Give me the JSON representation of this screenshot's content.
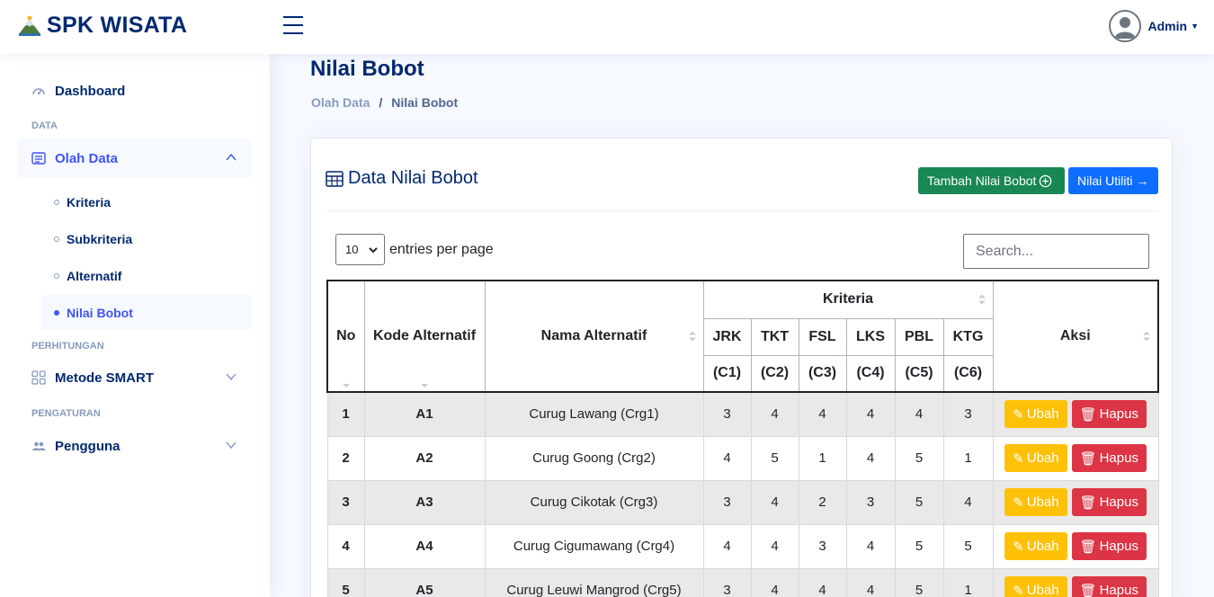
{
  "header": {
    "app_title": "SPK WISATA",
    "user_name": "Admin"
  },
  "sidebar": {
    "dashboard": "Dashboard",
    "heading_data": "DATA",
    "olah_data": "Olah Data",
    "sub_items": [
      "Kriteria",
      "Subkriteria",
      "Alternatif",
      "Nilai Bobot"
    ],
    "heading_perhitungan": "PERHITUNGAN",
    "metode_smart": "Metode SMART",
    "heading_pengaturan": "PENGATURAN",
    "pengguna": "Pengguna"
  },
  "page": {
    "title": "Nilai Bobot",
    "breadcrumb": [
      "Olah Data",
      "/",
      "Nilai Bobot"
    ]
  },
  "card": {
    "title": "Data Nilai Bobot",
    "btn_add": "Tambah Nilai Bobot",
    "btn_utiliti": "Nilai Utiliti"
  },
  "table_controls": {
    "page_size": "10",
    "entries_label": "entries per page",
    "search_placeholder": "Search..."
  },
  "table": {
    "headers": {
      "no": "No",
      "kode": "Kode Alternatif",
      "nama": "Nama Alternatif",
      "kriteria": "Kriteria",
      "aksi": "Aksi"
    },
    "criteria": [
      {
        "code": "JRK",
        "label": "(C1)"
      },
      {
        "code": "TKT",
        "label": "(C2)"
      },
      {
        "code": "FSL",
        "label": "(C3)"
      },
      {
        "code": "LKS",
        "label": "(C4)"
      },
      {
        "code": "PBL",
        "label": "(C5)"
      },
      {
        "code": "KTG",
        "label": "(C6)"
      }
    ],
    "rows": [
      {
        "no": "1",
        "kode": "A1",
        "nama": "Curug Lawang (Crg1)",
        "values": [
          "3",
          "4",
          "4",
          "4",
          "4",
          "3"
        ]
      },
      {
        "no": "2",
        "kode": "A2",
        "nama": "Curug Goong (Crg2)",
        "values": [
          "4",
          "5",
          "1",
          "4",
          "5",
          "1"
        ]
      },
      {
        "no": "3",
        "kode": "A3",
        "nama": "Curug Cikotak (Crg3)",
        "values": [
          "3",
          "4",
          "2",
          "3",
          "5",
          "4"
        ]
      },
      {
        "no": "4",
        "kode": "A4",
        "nama": "Curug Cigumawang (Crg4)",
        "values": [
          "4",
          "4",
          "3",
          "4",
          "5",
          "5"
        ]
      },
      {
        "no": "5",
        "kode": "A5",
        "nama": "Curug Leuwi Mangrod (Crg5)",
        "values": [
          "3",
          "4",
          "4",
          "4",
          "5",
          "1"
        ]
      }
    ],
    "btn_ubah": "Ubah",
    "btn_hapus": "Hapus"
  }
}
